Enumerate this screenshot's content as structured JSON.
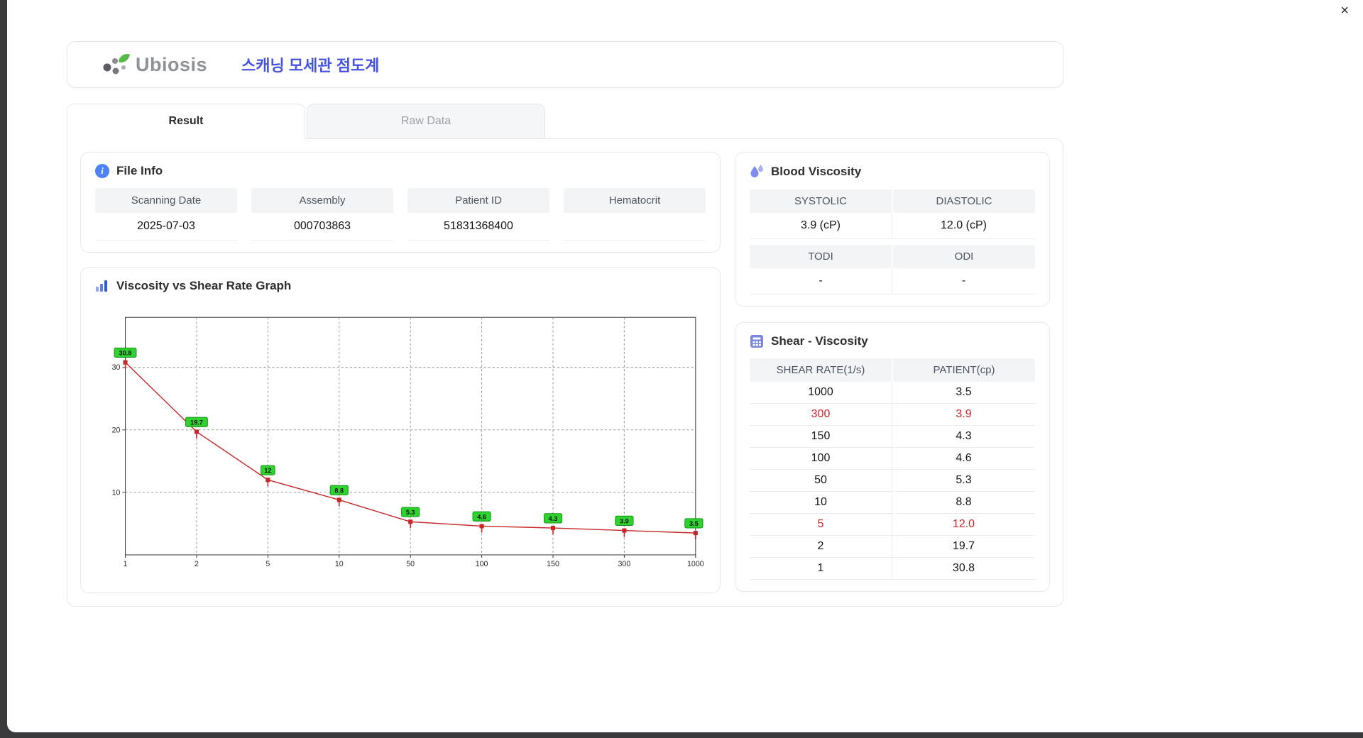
{
  "window": {
    "close_label": "×"
  },
  "header": {
    "logo_text": "Ubiosis",
    "title": "스캐닝 모세관 점도계"
  },
  "tabs": [
    {
      "label": "Result",
      "active": true
    },
    {
      "label": "Raw Data",
      "active": false
    }
  ],
  "icons": {
    "logo_mark": "leaf-dot-cluster",
    "file_info": "info-circle",
    "blood_viscosity": "water-droplets",
    "graph": "bar-chart",
    "shear": "calculator-grid"
  },
  "file_info": {
    "title": "File Info",
    "fields": [
      {
        "label": "Scanning Date",
        "value": "2025-07-03"
      },
      {
        "label": "Assembly",
        "value": "000703863"
      },
      {
        "label": "Patient ID",
        "value": "51831368400"
      },
      {
        "label": "Hematocrit",
        "value": ""
      }
    ]
  },
  "blood_viscosity": {
    "title": "Blood Viscosity",
    "rows": [
      {
        "headers": [
          "SYSTOLIC",
          "DIASTOLIC"
        ],
        "values": [
          "3.9 (cP)",
          "12.0 (cP)"
        ]
      },
      {
        "headers": [
          "TODI",
          "ODI"
        ],
        "values": [
          "-",
          "-"
        ]
      }
    ]
  },
  "graph": {
    "title": "Viscosity vs Shear Rate Graph"
  },
  "chart_data": {
    "type": "line",
    "title": "Viscosity vs Shear Rate Graph",
    "xlabel": "",
    "ylabel": "",
    "x": [
      1,
      2,
      5,
      10,
      50,
      100,
      150,
      300,
      1000
    ],
    "x_scale": "categorical-log-like",
    "values": [
      30.8,
      19.7,
      12,
      8.8,
      5.3,
      4.6,
      4.3,
      3.9,
      3.5
    ],
    "point_labels": [
      "30.8",
      "19.7",
      "12",
      "8.8",
      "5.3",
      "4.6",
      "4.3",
      "3.9",
      "3.5"
    ],
    "yticks": [
      10,
      20,
      30
    ],
    "ylim": [
      0,
      38
    ],
    "grid": "dashed",
    "line_color": "#c62828",
    "marker_color": "#c62828",
    "label_bg": "#2fd32f",
    "label_border": "#169416"
  },
  "shear_table": {
    "title": "Shear - Viscosity",
    "columns": [
      "SHEAR RATE(1/s)",
      "PATIENT(cp)"
    ],
    "highlight_color": "#c62828",
    "rows": [
      {
        "shear": "1000",
        "patient": "3.5",
        "highlight": false
      },
      {
        "shear": "300",
        "patient": "3.9",
        "highlight": true
      },
      {
        "shear": "150",
        "patient": "4.3",
        "highlight": false
      },
      {
        "shear": "100",
        "patient": "4.6",
        "highlight": false
      },
      {
        "shear": "50",
        "patient": "5.3",
        "highlight": false
      },
      {
        "shear": "10",
        "patient": "8.8",
        "highlight": false
      },
      {
        "shear": "5",
        "patient": "12.0",
        "highlight": true
      },
      {
        "shear": "2",
        "patient": "19.7",
        "highlight": false
      },
      {
        "shear": "1",
        "patient": "30.8",
        "highlight": false
      }
    ]
  }
}
